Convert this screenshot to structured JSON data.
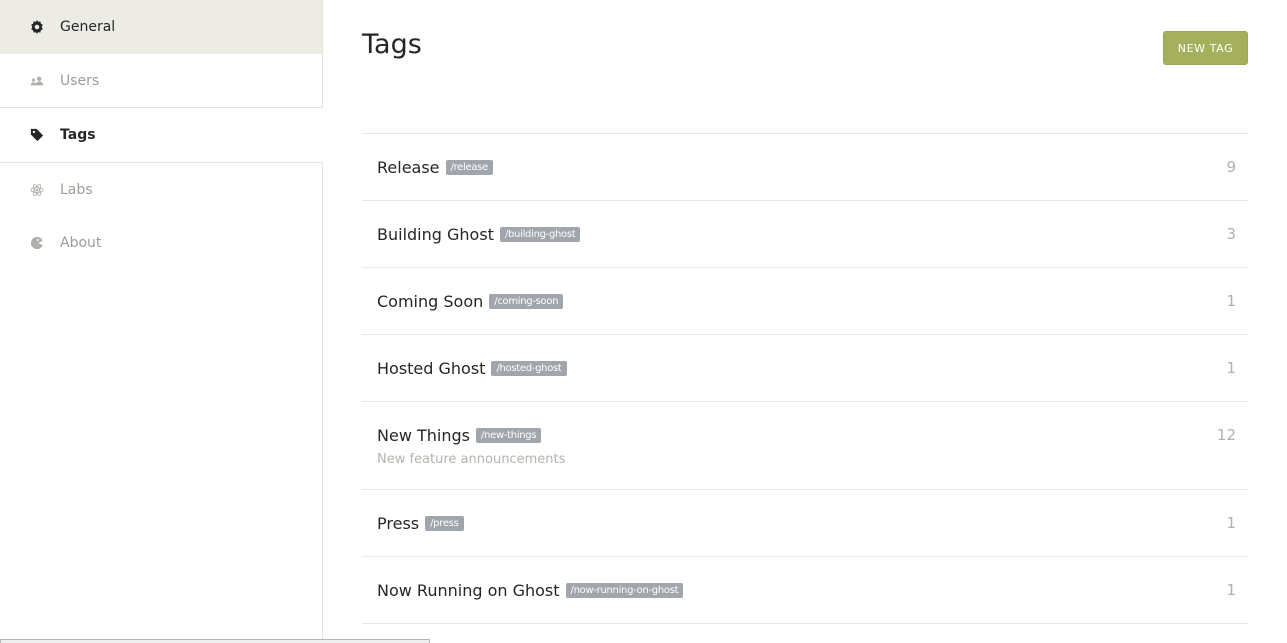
{
  "sidebar": {
    "items": [
      {
        "label": "General",
        "icon": "gear-icon",
        "active": false
      },
      {
        "label": "Users",
        "icon": "users-icon",
        "active": false
      },
      {
        "label": "Tags",
        "icon": "tag-icon",
        "active": true
      },
      {
        "label": "Labs",
        "icon": "atom-icon",
        "active": false
      },
      {
        "label": "About",
        "icon": "ghost-icon",
        "active": false
      }
    ]
  },
  "header": {
    "title": "Tags",
    "new_tag_label": "NEW TAG"
  },
  "colors": {
    "accent": "#a4b05b",
    "slug_badge": "#a0a6ab",
    "sidebar_hover": "#edece4"
  },
  "tags": [
    {
      "name": "Release",
      "slug": "/release",
      "description": "",
      "count": "9"
    },
    {
      "name": "Building Ghost",
      "slug": "/building-ghost",
      "description": "",
      "count": "3"
    },
    {
      "name": "Coming Soon",
      "slug": "/coming-soon",
      "description": "",
      "count": "1"
    },
    {
      "name": "Hosted Ghost",
      "slug": "/hosted-ghost",
      "description": "",
      "count": "1"
    },
    {
      "name": "New Things",
      "slug": "/new-things",
      "description": "New feature announcements",
      "count": "12"
    },
    {
      "name": "Press",
      "slug": "/press",
      "description": "",
      "count": "1"
    },
    {
      "name": "Now Running on Ghost",
      "slug": "/now-running-on-ghost",
      "description": "",
      "count": "1"
    }
  ]
}
